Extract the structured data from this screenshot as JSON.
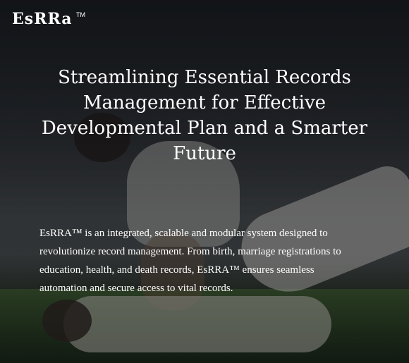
{
  "brand": {
    "logo_text": "EsRRa",
    "trademark": "TM"
  },
  "hero": {
    "headline": "Streamlining Essential Records Management for Effective Developmental Plan and a Smarter Future",
    "description": "EsRRA™ is an integrated, scalable and modular system designed to revolutionize record management. From birth, marriage registrations to education, health, and death records, EsRRA™ ensures seamless automation and secure access to vital records."
  },
  "colors": {
    "text": "#ffffff",
    "overlay": "#121418"
  }
}
